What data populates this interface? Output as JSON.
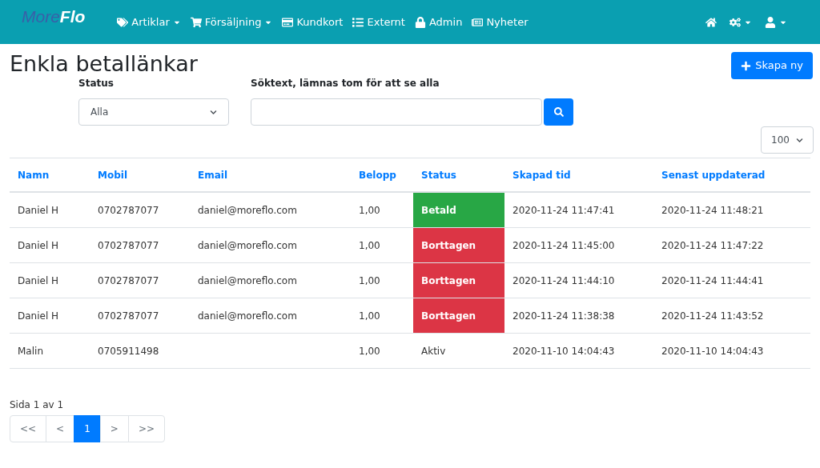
{
  "logo": {
    "first": "More",
    "second": "Flo"
  },
  "nav": [
    {
      "label": "Artiklar",
      "dropdown": true
    },
    {
      "label": "Försäljning",
      "dropdown": true
    },
    {
      "label": "Kundkort",
      "dropdown": false
    },
    {
      "label": "Externt",
      "dropdown": false
    },
    {
      "label": "Admin",
      "dropdown": false
    },
    {
      "label": "Nyheter",
      "dropdown": false
    }
  ],
  "nav_right": [
    {
      "dropdown": false
    },
    {
      "dropdown": true
    },
    {
      "dropdown": true
    }
  ],
  "page_title": "Enkla betallänkar",
  "create_button": "Skapa ny",
  "status_filter": {
    "label": "Status",
    "value": "Alla"
  },
  "search": {
    "label": "Söktext, lämnas tom för att se alla"
  },
  "page_size": "100",
  "table": {
    "columns": [
      "Namn",
      "Mobil",
      "Email",
      "Belopp",
      "Status",
      "Skapad tid",
      "Senast uppdaterad"
    ],
    "rows": [
      {
        "cells": [
          "Daniel H",
          "0702787077",
          "daniel@moreflo.com",
          "1,00",
          "Betald",
          "2020-11-24 11:47:41",
          "2020-11-24 11:48:21"
        ],
        "kind": "paid"
      },
      {
        "cells": [
          "Daniel H",
          "0702787077",
          "daniel@moreflo.com",
          "1,00",
          "Borttagen",
          "2020-11-24 11:45:00",
          "2020-11-24 11:47:22"
        ],
        "kind": "removed"
      },
      {
        "cells": [
          "Daniel H",
          "0702787077",
          "daniel@moreflo.com",
          "1,00",
          "Borttagen",
          "2020-11-24 11:44:10",
          "2020-11-24 11:44:41"
        ],
        "kind": "removed"
      },
      {
        "cells": [
          "Daniel H",
          "0702787077",
          "daniel@moreflo.com",
          "1,00",
          "Borttagen",
          "2020-11-24 11:38:38",
          "2020-11-24 11:43:52"
        ],
        "kind": "removed"
      },
      {
        "cells": [
          "Malin",
          "0705911498",
          "",
          "1,00",
          "Aktiv",
          "2020-11-10 14:04:43",
          "2020-11-10 14:04:43"
        ],
        "kind": "active"
      }
    ]
  },
  "page_info": "Sida 1 av 1",
  "pagination": [
    {
      "label": "<<",
      "selected": false
    },
    {
      "label": "<",
      "selected": false
    },
    {
      "label": "1",
      "selected": true
    },
    {
      "label": ">",
      "selected": false
    },
    {
      "label": ">>",
      "selected": false
    }
  ]
}
